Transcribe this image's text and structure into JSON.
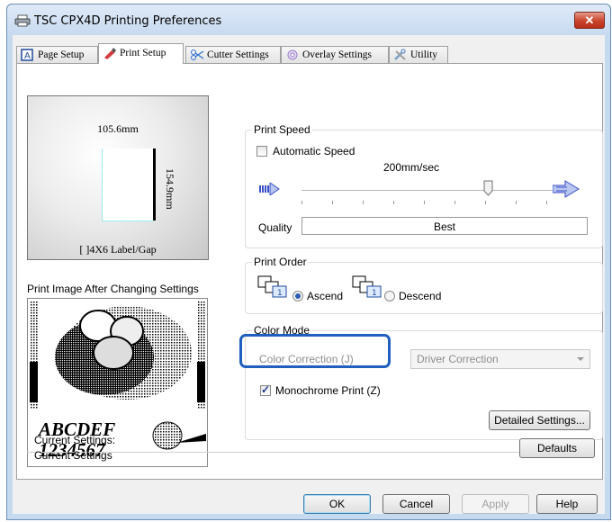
{
  "window": {
    "title": "TSC CPX4D Printing Preferences",
    "close_label": "✕"
  },
  "tabs": [
    {
      "label": "Page Setup",
      "icon": "page-setup-icon"
    },
    {
      "label": "Print Setup",
      "icon": "print-setup-icon"
    },
    {
      "label": "Cutter Settings",
      "icon": "scissors-icon"
    },
    {
      "label": "Overlay Settings",
      "icon": "overlay-icon"
    },
    {
      "label": "Utility",
      "icon": "tools-icon"
    }
  ],
  "preview": {
    "width_label": "105.6mm",
    "height_label": "154.9mm",
    "paper_label": "[ ]4X6 Label/Gap"
  },
  "print_image_label": "Print Image After Changing Settings",
  "sample": {
    "line1": "ABCDEF",
    "line2": "1234567"
  },
  "print_speed": {
    "title": "Print Speed",
    "auto_label": "Automatic Speed",
    "auto_checked": false,
    "speed_value": "200mm/sec",
    "quality_label": "Quality",
    "quality_value": "Best"
  },
  "print_order": {
    "title": "Print Order",
    "ascend_label": "Ascend",
    "descend_label": "Descend",
    "selected": "ascend"
  },
  "color_mode": {
    "title": "Color Mode",
    "correction_label": "Color Correction (J)",
    "correction_value": "Driver Correction",
    "monochrome_label": "Monochrome Print (Z)",
    "monochrome_checked": true,
    "detailed_button": "Detailed Settings..."
  },
  "current": {
    "heading": "Current Settings:",
    "value": "Current Settings",
    "defaults_button": "Defaults"
  },
  "footer": {
    "ok": "OK",
    "cancel": "Cancel",
    "apply": "Apply",
    "help": "Help"
  },
  "colors": {
    "highlight": "#1f5fbf",
    "title_bar": "#c7daf0",
    "close": "#c9432b"
  }
}
